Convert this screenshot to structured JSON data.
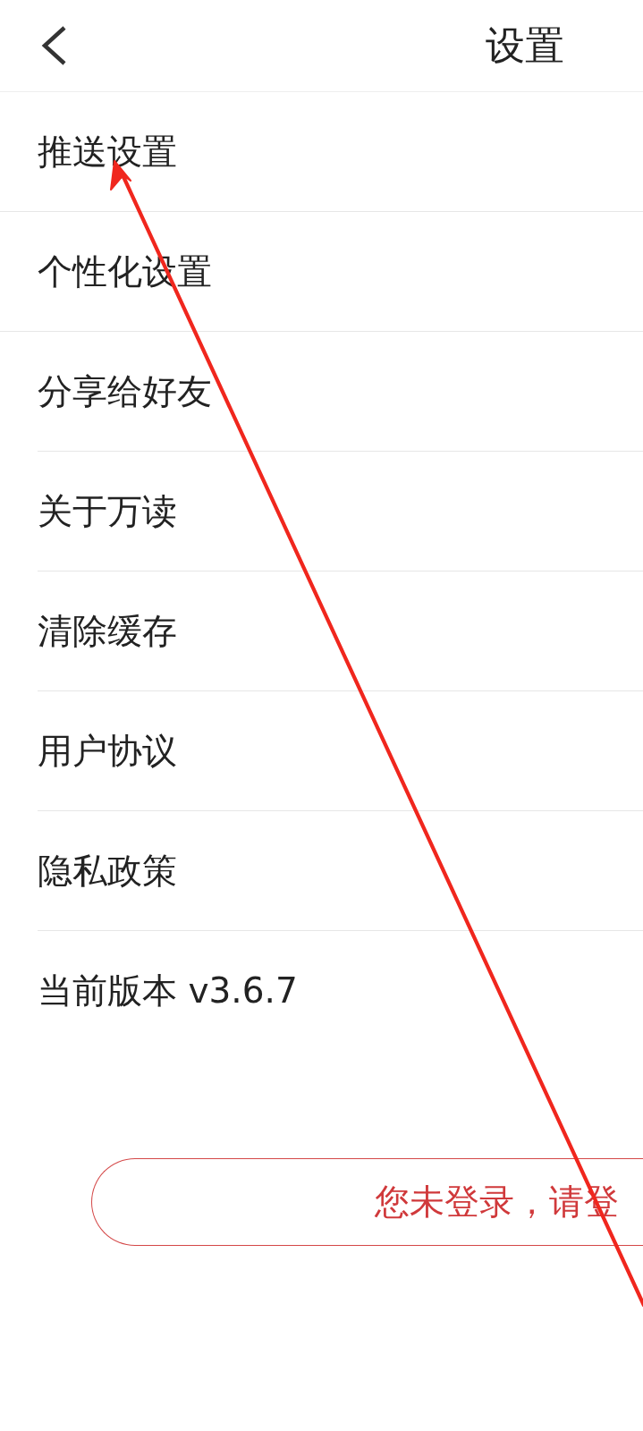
{
  "header": {
    "title": "设置"
  },
  "items": [
    {
      "label": "推送设置",
      "kind": "section"
    },
    {
      "label": "个性化设置",
      "kind": "section"
    },
    {
      "label": "分享给好友",
      "kind": "item"
    },
    {
      "label": "关于万读",
      "kind": "item"
    },
    {
      "label": "清除缓存",
      "kind": "item"
    },
    {
      "label": "用户协议",
      "kind": "item"
    },
    {
      "label": "隐私政策",
      "kind": "item"
    },
    {
      "label": "当前版本 v3.6.7",
      "kind": "last"
    }
  ],
  "login_button": {
    "label": "您未登录，请登"
  }
}
